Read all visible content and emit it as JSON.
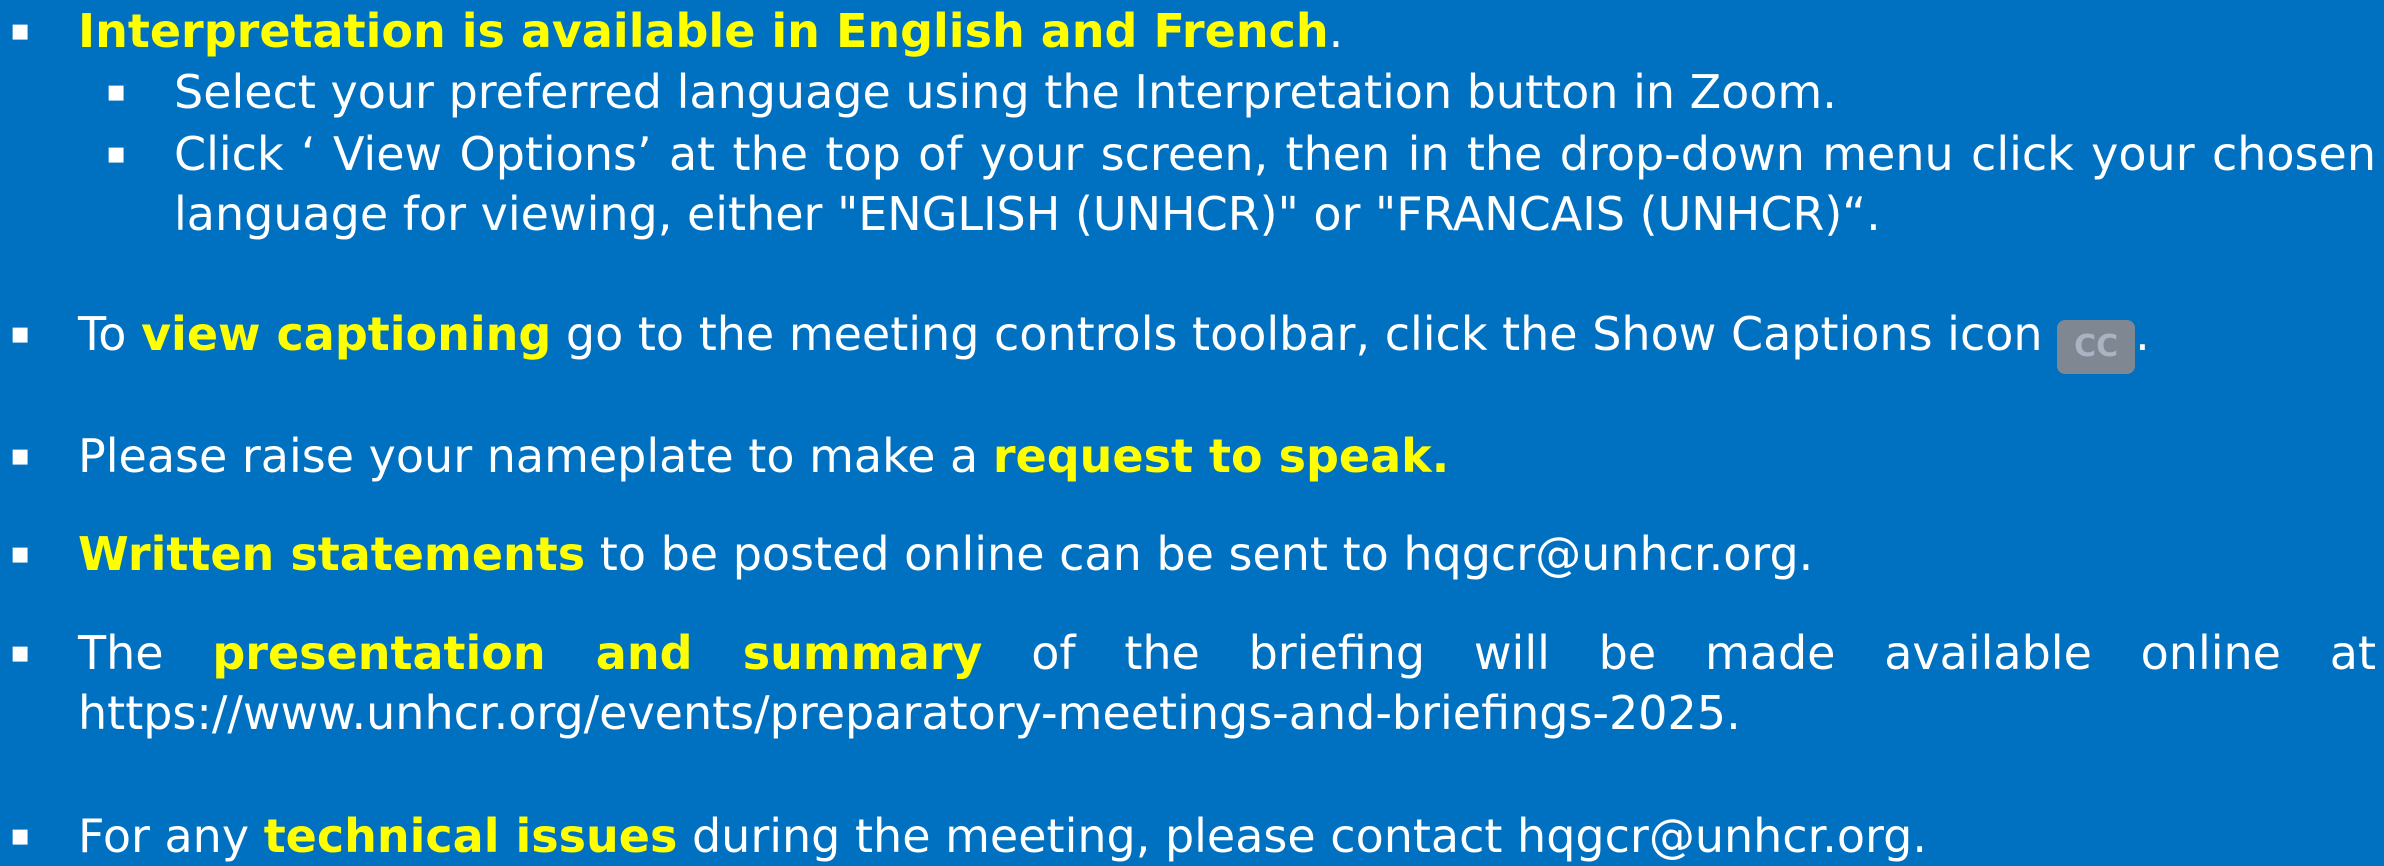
{
  "bullet_glyph": "▪",
  "items": {
    "interpretation": {
      "highlight": "Interpretation is available in English and French",
      "end": ".",
      "sub1": "Select your preferred language using the Interpretation button in Zoom.",
      "sub2": "Click ‘ View Options’ at the top of your screen, then in the drop-down menu click your chosen language for viewing, either \"ENGLISH (UNHCR)\" or  \"FRANCAIS (UNHCR)“."
    },
    "captioning": {
      "pre": "To ",
      "highlight": "view captioning",
      "post": " go to the meeting controls toolbar, click the Show Captions icon ",
      "icon_label": "CC",
      "end": "."
    },
    "speak": {
      "pre": "Please raise your nameplate to make a ",
      "highlight": "request to speak."
    },
    "statements": {
      "highlight": "Written statements",
      "post": " to be posted online can be sent to hqgcr@unhcr.org."
    },
    "presentation": {
      "pre": "The ",
      "highlight": "presentation and summary",
      "post": " of the briefing will be made available online at https://www.unhcr.org/events/preparatory-meetings-and-briefings-2025."
    },
    "technical": {
      "pre": "For any ",
      "highlight": "technical issues",
      "post": " during the meeting, please contact hqgcr@unhcr.org."
    }
  },
  "colors": {
    "background": "#0070c0",
    "text": "#ffffff",
    "highlight": "#ffff00",
    "cc_icon_bg": "#7f8792"
  }
}
